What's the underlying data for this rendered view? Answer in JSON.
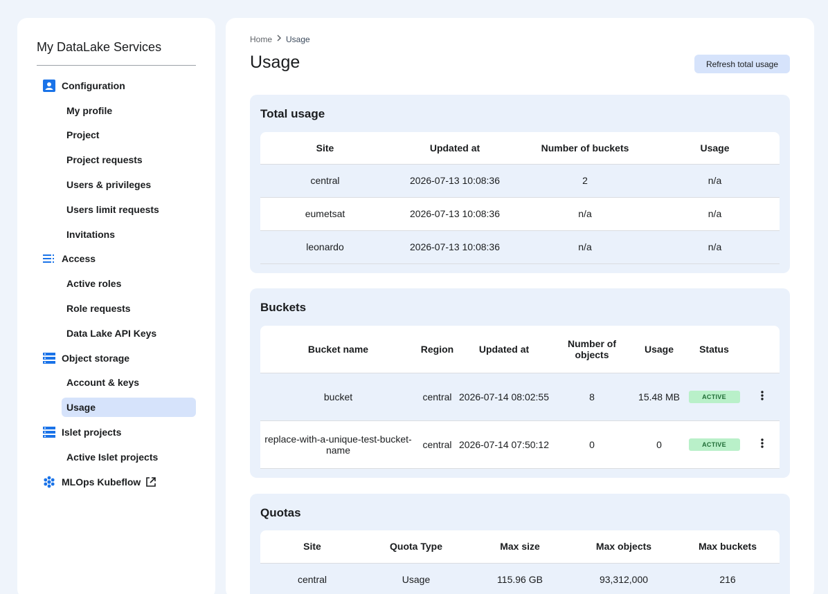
{
  "sidebar": {
    "title": "My DataLake Services",
    "sections": [
      {
        "label": "Configuration",
        "icon": "account-box-icon",
        "items": [
          "My profile",
          "Project",
          "Project requests",
          "Users & privileges",
          "Users limit requests",
          "Invitations"
        ]
      },
      {
        "label": "Access",
        "icon": "list-icon",
        "items": [
          "Active roles",
          "Role requests",
          "Data Lake API Keys"
        ]
      },
      {
        "label": "Object storage",
        "icon": "storage-icon",
        "items": [
          "Account & keys",
          "Usage"
        ]
      },
      {
        "label": "Islet projects",
        "icon": "storage-icon",
        "items": [
          "Active Islet projects"
        ]
      },
      {
        "label": "MLOps Kubeflow",
        "icon": "hub-icon",
        "items": []
      }
    ],
    "active_item": "Usage"
  },
  "breadcrumb": {
    "home": "Home",
    "current": "Usage"
  },
  "page": {
    "title": "Usage",
    "refresh_label": "Refresh total usage"
  },
  "total_usage": {
    "title": "Total usage",
    "columns": [
      "Site",
      "Updated at",
      "Number of buckets",
      "Usage"
    ],
    "rows": [
      [
        "central",
        "2026-07-13 10:08:36",
        "2",
        "n/a"
      ],
      [
        "eumetsat",
        "2026-07-13 10:08:36",
        "n/a",
        "n/a"
      ],
      [
        "leonardo",
        "2026-07-13 10:08:36",
        "n/a",
        "n/a"
      ]
    ]
  },
  "buckets": {
    "title": "Buckets",
    "columns": [
      "Bucket name",
      "Region",
      "Updated at",
      "Number of objects",
      "Usage",
      "Status"
    ],
    "rows": [
      [
        "bucket",
        "central",
        "2026-07-14 08:02:55",
        "8",
        "15.48 MB",
        "ACTIVE"
      ],
      [
        "replace-with-a-unique-test-bucket-name",
        "central",
        "2026-07-14 07:50:12",
        "0",
        "0",
        "ACTIVE"
      ]
    ]
  },
  "quotas": {
    "title": "Quotas",
    "columns": [
      "Site",
      "Quota Type",
      "Max size",
      "Max objects",
      "Max buckets"
    ],
    "rows": [
      [
        "central",
        "Usage",
        "115.96 GB",
        "93,312,000",
        "216"
      ]
    ]
  },
  "colors": {
    "accent": "#1a73e8",
    "active_bg": "#d6e3fb",
    "badge_bg": "#b9f0c9",
    "badge_text": "#1f6b35"
  }
}
